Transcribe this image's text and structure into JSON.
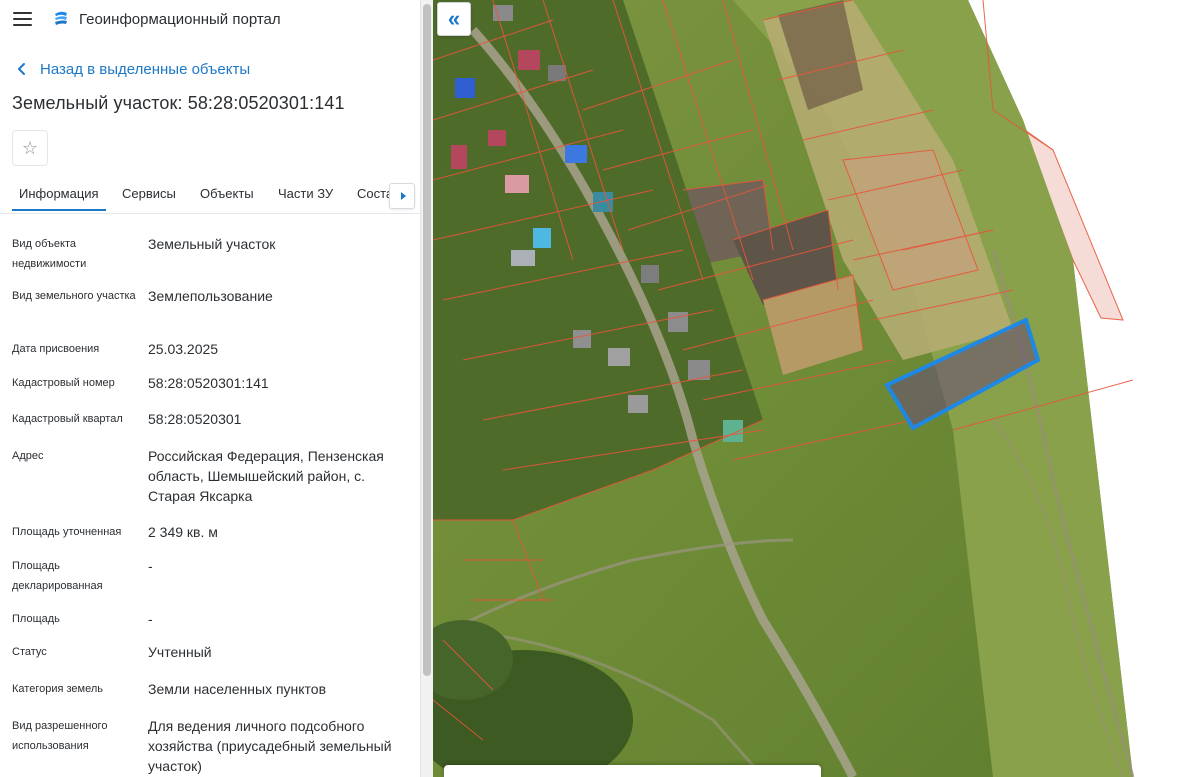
{
  "header": {
    "title": "Геоинформационный портал",
    "menu_icon": "hamburger-icon",
    "logo_icon": "portal-logo-icon"
  },
  "back": {
    "label": "Назад в выделенные объекты",
    "icon": "chevron-left-icon"
  },
  "object": {
    "title": "Земельный участок: 58:28:0520301:141",
    "favorite_icon": "star-icon"
  },
  "tabs": [
    {
      "label": "Информация",
      "active": true
    },
    {
      "label": "Сервисы",
      "active": false
    },
    {
      "label": "Объекты",
      "active": false
    },
    {
      "label": "Части ЗУ",
      "active": false
    },
    {
      "label": "Соста",
      "active": false
    }
  ],
  "properties": [
    {
      "label": "Вид объекта недвижимости",
      "value": "Земельный участок"
    },
    {
      "label": "Вид земельного участка",
      "value": "Землепользование"
    },
    {
      "label": "Дата присвоения",
      "value": "25.03.2025"
    },
    {
      "label": "Кадастровый номер",
      "value": "58:28:0520301:141"
    },
    {
      "label": "Кадастровый квартал",
      "value": "58:28:0520301"
    },
    {
      "label": "Адрес",
      "value": "Российская Федерация, Пензенская область, Шемышейский район, с. Старая Яксарка"
    },
    {
      "label": "Площадь уточненная",
      "value": "2 349 кв. м"
    },
    {
      "label": "Площадь декларированная",
      "value": "-"
    },
    {
      "label": "Площадь",
      "value": "-"
    },
    {
      "label": "Статус",
      "value": "Учтенный"
    },
    {
      "label": "Категория земель",
      "value": "Земли населенных пунктов"
    },
    {
      "label": "Вид разрешенного использования",
      "value": "Для ведения личного подсобного хозяйства (приусадебный земельный участок)"
    }
  ],
  "map": {
    "collapse_label": "«",
    "highlight_color": "#1e88e5",
    "parcel_line_color": "#e8553a"
  },
  "colors": {
    "accent": "#1e78c8"
  }
}
